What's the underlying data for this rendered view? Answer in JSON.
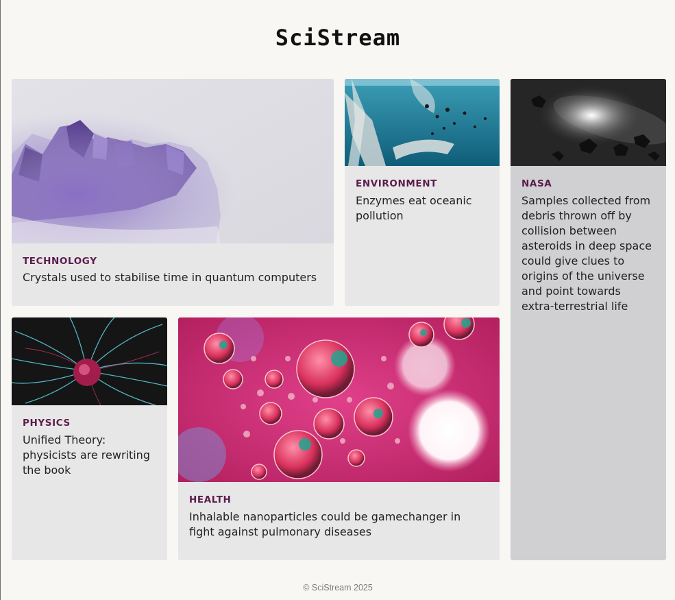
{
  "site": {
    "title": "SciStream"
  },
  "articles": [
    {
      "category": "TECHNOLOGY",
      "headline": "Crystals used to stabilise time in quantum computers",
      "image": "amethyst-crystal-photo"
    },
    {
      "category": "ENVIRONMENT",
      "headline": "Enzymes eat oceanic pollution",
      "image": "ocean-plastic-photo"
    },
    {
      "category": "NASA",
      "headline": "Samples collected from debris thrown off by collision between asteroids in deep space could give clues to origins of the universe and point towards extra-terrestrial life",
      "image": "asteroid-space-photo"
    },
    {
      "category": "PHYSICS",
      "headline": "Unified Theory: physicists are rewriting the book",
      "image": "plasma-ball-photo"
    },
    {
      "category": "HEALTH",
      "headline": "Inhalable nanoparticles could be gamechanger in fight against pulmonary diseases",
      "image": "pink-bubbles-photo"
    }
  ],
  "footer": {
    "text": "© SciStream 2025"
  },
  "colors": {
    "category": "#5b1b4c",
    "card": "#e8e7e8",
    "card_tall": "#d0d0d2",
    "background": "#f8f7f4"
  }
}
